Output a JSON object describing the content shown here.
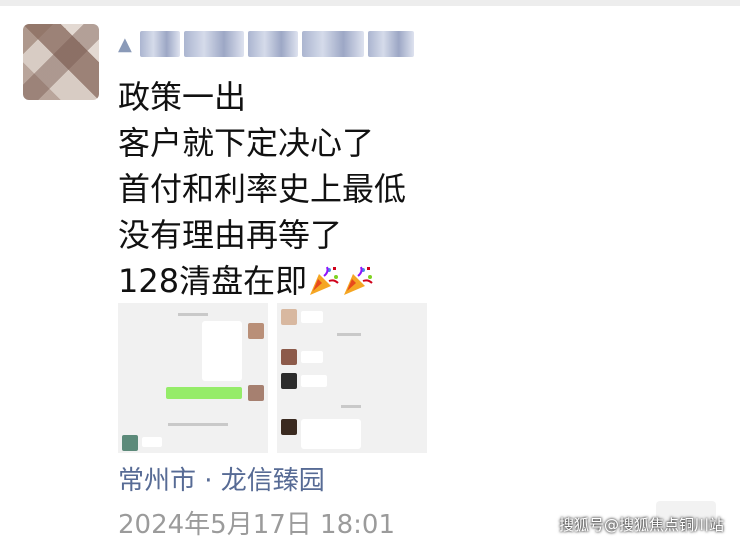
{
  "post": {
    "lines": [
      "政策一出",
      "客户就下定决心了",
      "首付和利率史上最低",
      "没有理由再等了",
      "128清盘在即"
    ],
    "emoji": [
      "party-popper",
      "party-popper"
    ],
    "location": "常州市 · 龙信臻园",
    "timestamp": "2024年5月17日 18:01"
  },
  "watermark": "搜狐号@搜狐焦点铜川站",
  "colors": {
    "link": "#576b95",
    "timestamp": "#9b9b9b",
    "chat_green": "#95ec69"
  }
}
